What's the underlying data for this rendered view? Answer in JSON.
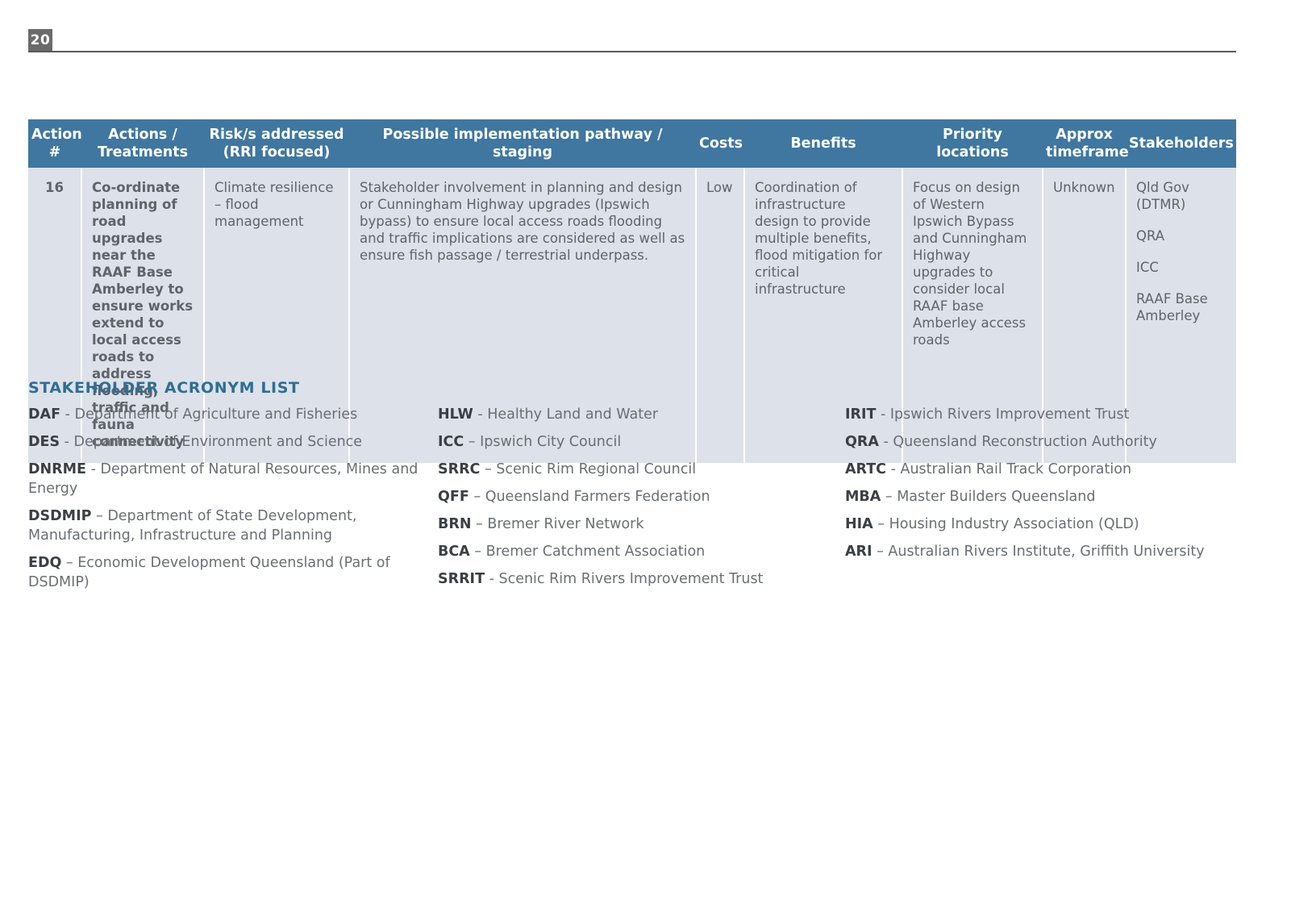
{
  "page": {
    "number": "20"
  },
  "table": {
    "headers": [
      "Action #",
      "Actions / Treatments",
      "Risk/s addressed (RRI focused)",
      "Possible implementation pathway / staging",
      "Costs",
      "Benefits",
      "Priority locations",
      "Approx timeframe",
      "Stakeholders"
    ],
    "header_lines": {
      "action_num_1": "Action",
      "action_num_2": "#",
      "actions_1": "Actions /",
      "actions_2": "Treatments",
      "risks_1": "Risk/s addressed",
      "risks_2": "(RRI focused)",
      "pathway_1": "Possible implementation pathway /",
      "pathway_2": "staging",
      "costs": "Costs",
      "benefits": "Benefits",
      "priority": "Priority locations",
      "timeframe_1": "Approx",
      "timeframe_2": "timeframe",
      "stakeholders": "Stakeholders"
    },
    "rows": [
      {
        "action_number": "16",
        "action_treatment": "Co-ordinate planning of road upgrades near the RAAF Base Amberley to ensure works extend to local access roads to address flooding, traffic and fauna connectivity",
        "risks_addressed": "Climate resilience – flood management",
        "implementation_pathway": "Stakeholder involvement in planning and design or Cunningham Highway upgrades (Ipswich bypass) to ensure local access roads flooding and traffic implications are considered as well as ensure fish passage / terrestrial underpass.",
        "costs": "Low",
        "benefits": "Coordination of infrastructure design to provide multiple benefits, flood mitigation for critical infrastructure",
        "priority_locations": "Focus on design of Western Ipswich Bypass and Cunningham Highway upgrades to consider local RAAF base Amberley access roads",
        "approx_timeframe": "Unknown",
        "stakeholders": [
          "Qld Gov (DTMR)",
          "QRA",
          "ICC",
          "RAAF Base Amberley"
        ]
      }
    ]
  },
  "acronym_list": {
    "title": "STAKEHOLDER ACRONYM LIST",
    "columns": [
      [
        {
          "acronym": "DAF",
          "dash": " - ",
          "definition": "Department of Agriculture and Fisheries"
        },
        {
          "acronym": "DES",
          "dash": " - ",
          "definition": "Department of Environment and Science"
        },
        {
          "acronym": "DNRME",
          "dash": " - ",
          "definition": "Department of Natural Resources, Mines and Energy"
        },
        {
          "acronym": "DSDMIP",
          "dash": " – ",
          "definition": "Department of State Development, Manufacturing, Infrastructure and Planning"
        },
        {
          "acronym": "EDQ",
          "dash": " – ",
          "definition": "Economic Development Queensland (Part of DSDMIP)"
        }
      ],
      [
        {
          "acronym": "HLW",
          "dash": " - ",
          "definition": "Healthy Land and Water"
        },
        {
          "acronym": "ICC",
          "dash": " – ",
          "definition": "Ipswich City Council"
        },
        {
          "acronym": "SRRC",
          "dash": " – ",
          "definition": "Scenic Rim Regional Council"
        },
        {
          "acronym": "QFF",
          "dash": " – ",
          "definition": "Queensland Farmers Federation"
        },
        {
          "acronym": "BRN",
          "dash": " – ",
          "definition": "Bremer River Network"
        },
        {
          "acronym": "BCA",
          "dash": " – ",
          "definition": "Bremer Catchment Association"
        },
        {
          "acronym": "SRRIT",
          "dash": " - ",
          "definition": "Scenic Rim Rivers Improvement Trust"
        }
      ],
      [
        {
          "acronym": "IRIT",
          "dash": " - ",
          "definition": "Ipswich Rivers Improvement Trust"
        },
        {
          "acronym": "QRA",
          "dash": " - ",
          "definition": "Queensland Reconstruction Authority"
        },
        {
          "acronym": "ARTC",
          "dash": " - ",
          "definition": "Australian Rail Track Corporation"
        },
        {
          "acronym": "MBA",
          "dash": " – ",
          "definition": "Master Builders Queensland"
        },
        {
          "acronym": "HIA",
          "dash": " – ",
          "definition": "Housing Industry Association (QLD)"
        },
        {
          "acronym": "ARI",
          "dash": " – ",
          "definition": "Australian Rivers Institute, Griffith University"
        }
      ]
    ]
  },
  "colors": {
    "header_blue": "#3f77a0",
    "row_grey": "#dde1e9",
    "title_blue": "#2e6e93",
    "page_number_bg": "#6b6b6b",
    "body_text": "#6a6e74"
  }
}
